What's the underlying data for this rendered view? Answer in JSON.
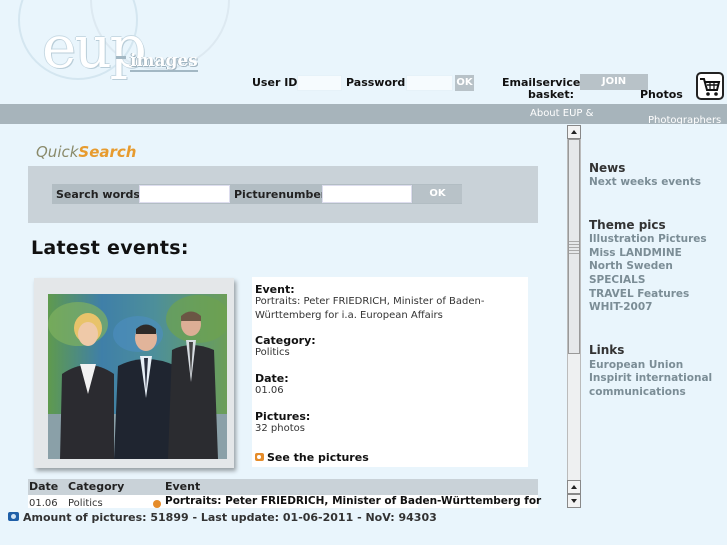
{
  "header": {
    "logo_text": "eup",
    "logo_sub": "images",
    "userid_label": "User ID",
    "password_label": "Password",
    "login_ok": "OK",
    "emailservice_label": "Emailservice",
    "join_label": "JOIN",
    "basket_label": "basket:",
    "photos_label": "Photos",
    "cart_icon": "shopping-cart-icon"
  },
  "nav": {
    "about_label": "About EUP &",
    "photographers_label": "Photographers"
  },
  "quicksearch": {
    "title_part1": "Quick",
    "title_part2": "Search",
    "search_words_label": "Search words",
    "picturenumber_label": "Picturenumber",
    "ok_label": "OK",
    "search_words_value": "",
    "picturenumber_value": ""
  },
  "latest": {
    "title": "Latest events:",
    "event_label": "Event:",
    "event_value": "Portraits: Peter FRIEDRICH, Minister of Baden-Württemberg for i.a. European Affairs",
    "category_label": "Category:",
    "category_value": "Politics",
    "date_label": "Date:",
    "date_value": "01.06",
    "pictures_label": "Pictures:",
    "pictures_value": "32 photos",
    "see_pictures": "See the pictures"
  },
  "table": {
    "headers": [
      "Date",
      "Category",
      "Event"
    ],
    "rows": [
      {
        "date": "01.06",
        "category": "Politics",
        "event": "Portraits: Peter FRIEDRICH, Minister of Baden-Württemberg for"
      }
    ]
  },
  "sidebar": {
    "news_head": "News",
    "news_items": [
      "Next weeks events"
    ],
    "theme_head": "Theme pics",
    "theme_items": [
      "Illustration Pictures",
      "Miss LANDMINE",
      "North Sweden",
      "SPECIALS",
      "TRAVEL Features",
      "WHIT-2007"
    ],
    "links_head": "Links",
    "links_items": [
      "European Union",
      "Inspirit international",
      "communications"
    ]
  },
  "footer": {
    "text": "Amount of pictures: 51899 - Last update: 01-06-2011 - NoV: 94303"
  },
  "colors": {
    "background": "#e9f5fc",
    "nav": "#a7b4bb",
    "accent_orange": "#e79b2e",
    "link_gray": "#7b8d96"
  }
}
